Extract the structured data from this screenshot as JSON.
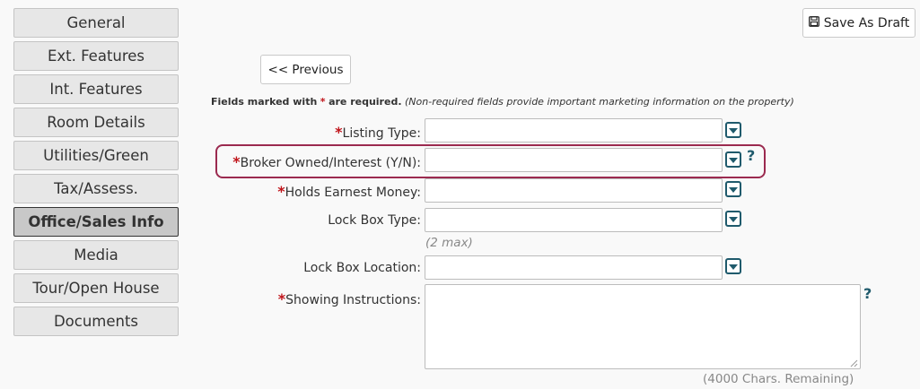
{
  "sidebar": {
    "items": [
      {
        "label": "General"
      },
      {
        "label": "Ext. Features"
      },
      {
        "label": "Int. Features"
      },
      {
        "label": "Room Details"
      },
      {
        "label": "Utilities/Green"
      },
      {
        "label": "Tax/Assess."
      },
      {
        "label": "Office/Sales Info"
      },
      {
        "label": "Media"
      },
      {
        "label": "Tour/Open House"
      },
      {
        "label": "Documents"
      }
    ],
    "active_item": "Office/Sales Info"
  },
  "toolbar": {
    "save_draft_label": "Save As Draft",
    "previous_label": "<< Previous"
  },
  "required_note": {
    "prefix": "Fields marked with",
    "star": "*",
    "suffix": "are required.",
    "italic": "(Non-required fields provide important marketing information on the property)"
  },
  "fields": {
    "listing_type": {
      "star": "*",
      "label": "Listing Type:",
      "value": ""
    },
    "broker_owned": {
      "star": "*",
      "label": "Broker Owned/Interest (Y/N):",
      "value": ""
    },
    "holds_earnest": {
      "star": "*",
      "label": "Holds Earnest Money:",
      "value": ""
    },
    "lock_box_type": {
      "label": "Lock Box Type:",
      "value": "",
      "hint": "(2 max)"
    },
    "lock_box_location": {
      "label": "Lock Box Location:",
      "value": ""
    },
    "showing_instructions": {
      "star": "*",
      "label": "Showing Instructions:",
      "value": "",
      "remaining": "(4000 Chars. Remaining)"
    }
  },
  "help_symbol": "?",
  "colors": {
    "required_star": "#c0141a",
    "highlight_border": "#9b2a4f",
    "icon_teal": "#1f5a6c",
    "active_tab": "#c8c8c8"
  }
}
